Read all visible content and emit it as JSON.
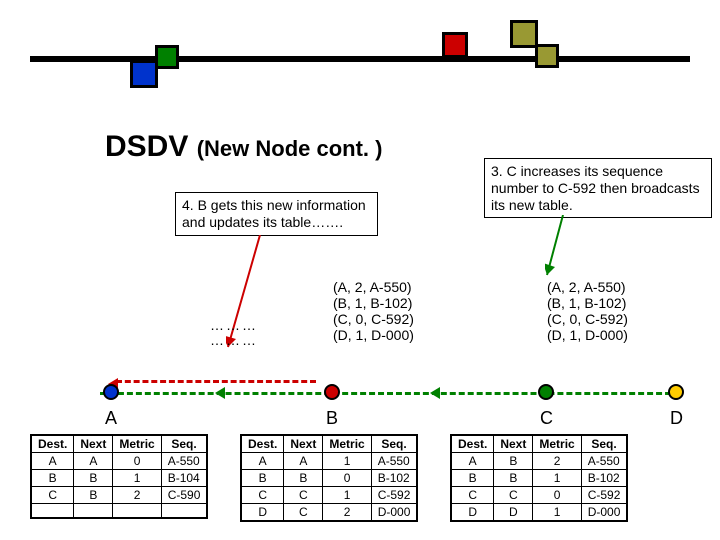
{
  "title_main": "DSDV",
  "title_sub": "(New Node cont. )",
  "box3": "3. C increases its sequence number to C-592 then broadcasts its new table.",
  "box4": "4. B gets this new information and updates its table…….",
  "dots1": "………",
  "dots2": "………",
  "tuples_b": {
    "l1": "(A, 2, A-550)",
    "l2": "(B, 1, B-102)",
    "l3": "(C, 0, C-592)",
    "l4": "(D, 1, D-000)"
  },
  "tuples_c": {
    "l1": "(A, 2, A-550)",
    "l2": "(B, 1, B-102)",
    "l3": "(C, 0, C-592)",
    "l4": "(D, 1, D-000)"
  },
  "nodes": {
    "a": "A",
    "b": "B",
    "c": "C",
    "d": "D"
  },
  "cols": {
    "dest": "Dest.",
    "next": "Next",
    "metric": "Metric",
    "seq": "Seq."
  },
  "tableA": {
    "r0": {
      "d": "A",
      "n": "A",
      "m": "0",
      "s": "A-550"
    },
    "r1": {
      "d": "B",
      "n": "B",
      "m": "1",
      "s": "B-104"
    },
    "r2": {
      "d": "C",
      "n": "B",
      "m": "2",
      "s": "C-590"
    }
  },
  "tableB": {
    "r0": {
      "d": "A",
      "n": "A",
      "m": "1",
      "s": "A-550"
    },
    "r1": {
      "d": "B",
      "n": "B",
      "m": "0",
      "s": "B-102"
    },
    "r2": {
      "d": "C",
      "n": "C",
      "m": "1",
      "s": "C-592"
    },
    "r3": {
      "d": "D",
      "n": "C",
      "m": "2",
      "s": "D-000"
    }
  },
  "tableC": {
    "r0": {
      "d": "A",
      "n": "B",
      "m": "2",
      "s": "A-550"
    },
    "r1": {
      "d": "B",
      "n": "B",
      "m": "1",
      "s": "B-102"
    },
    "r2": {
      "d": "C",
      "n": "C",
      "m": "0",
      "s": "C-592"
    },
    "r3": {
      "d": "D",
      "n": "D",
      "m": "1",
      "s": "D-000"
    }
  }
}
